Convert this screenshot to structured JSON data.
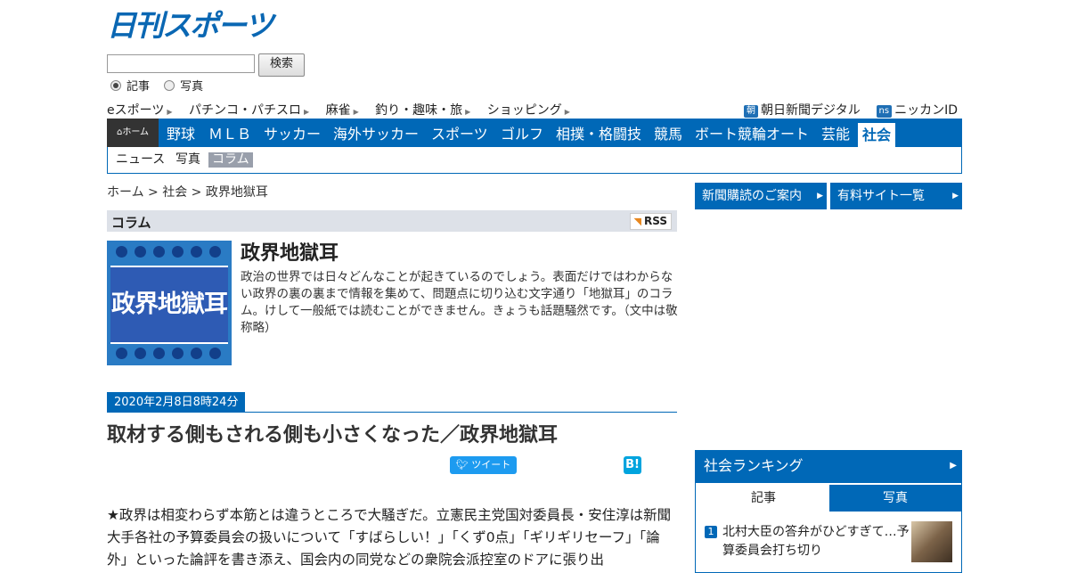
{
  "site": {
    "logo": "日刊スポーツ"
  },
  "search": {
    "value": "",
    "button": "検索",
    "radio_article": "記事",
    "radio_photo": "写真"
  },
  "sublinks": [
    "eスポーツ",
    "パチンコ・パチスロ",
    "麻雀",
    "釣り・趣味・旅",
    "ショッピング"
  ],
  "rightlinks": {
    "asahi_badge": "朝",
    "asahi": "朝日新聞デジタル",
    "ns_badge": "ns",
    "nikkan": "ニッカンID"
  },
  "nav": {
    "home": "ホーム",
    "items": [
      "野球",
      "ＭＬＢ",
      "サッカー",
      "海外サッカー",
      "スポーツ",
      "ゴルフ",
      "相撲・格闘技",
      "競馬",
      "ボート競輪オート",
      "芸能"
    ],
    "active": "社会"
  },
  "subnav": [
    "ニュース",
    "写真",
    "コラム"
  ],
  "breadcrumb": "ホーム > 社会 > 政界地獄耳",
  "column": {
    "header": "コラム",
    "rss": "RSS",
    "image_text": "政界地獄耳",
    "title": "政界地獄耳",
    "description": "政治の世界では日々どんなことが起きているのでしょう。表面だけではわからない政界の裏の裏まで情報を集めて、問題点に切り込む文字通り「地獄耳」のコラム。けして一般紙では読むことができません。きょうも話題騒然です。（文中は敬称略）"
  },
  "article": {
    "date": "2020年2月8日8時24分",
    "headline": "取材する側もされる側も小さくなった／政界地獄耳",
    "tweet": "ツイート",
    "hatena": "B!",
    "body": "★政界は相変わらず本筋とは違うところで大騒ぎだ。立憲民主党国対委員長・安住淳は新聞大手各社の予算委員会の扱いについて「すばらしい！」「くず0点」「ギリギリセーフ」「論外」といった論評を書き添え、国会内の同党などの衆院会派控室のドアに張り出"
  },
  "right": {
    "btn1": "新聞購読のご案内",
    "btn2": "有料サイト一覧",
    "ranking_title": "社会ランキング",
    "tab_article": "記事",
    "tab_photo": "写真",
    "rank1_num": "1",
    "rank1_text": "北村大臣の答弁がひどすぎて…予算委員会打ち切り"
  },
  "colors": {
    "brand": "#0068b7",
    "nav_home": "#333333",
    "subnav_active": "#999fab",
    "twitter": "#1d9bf0",
    "hatena": "#00a4de"
  }
}
